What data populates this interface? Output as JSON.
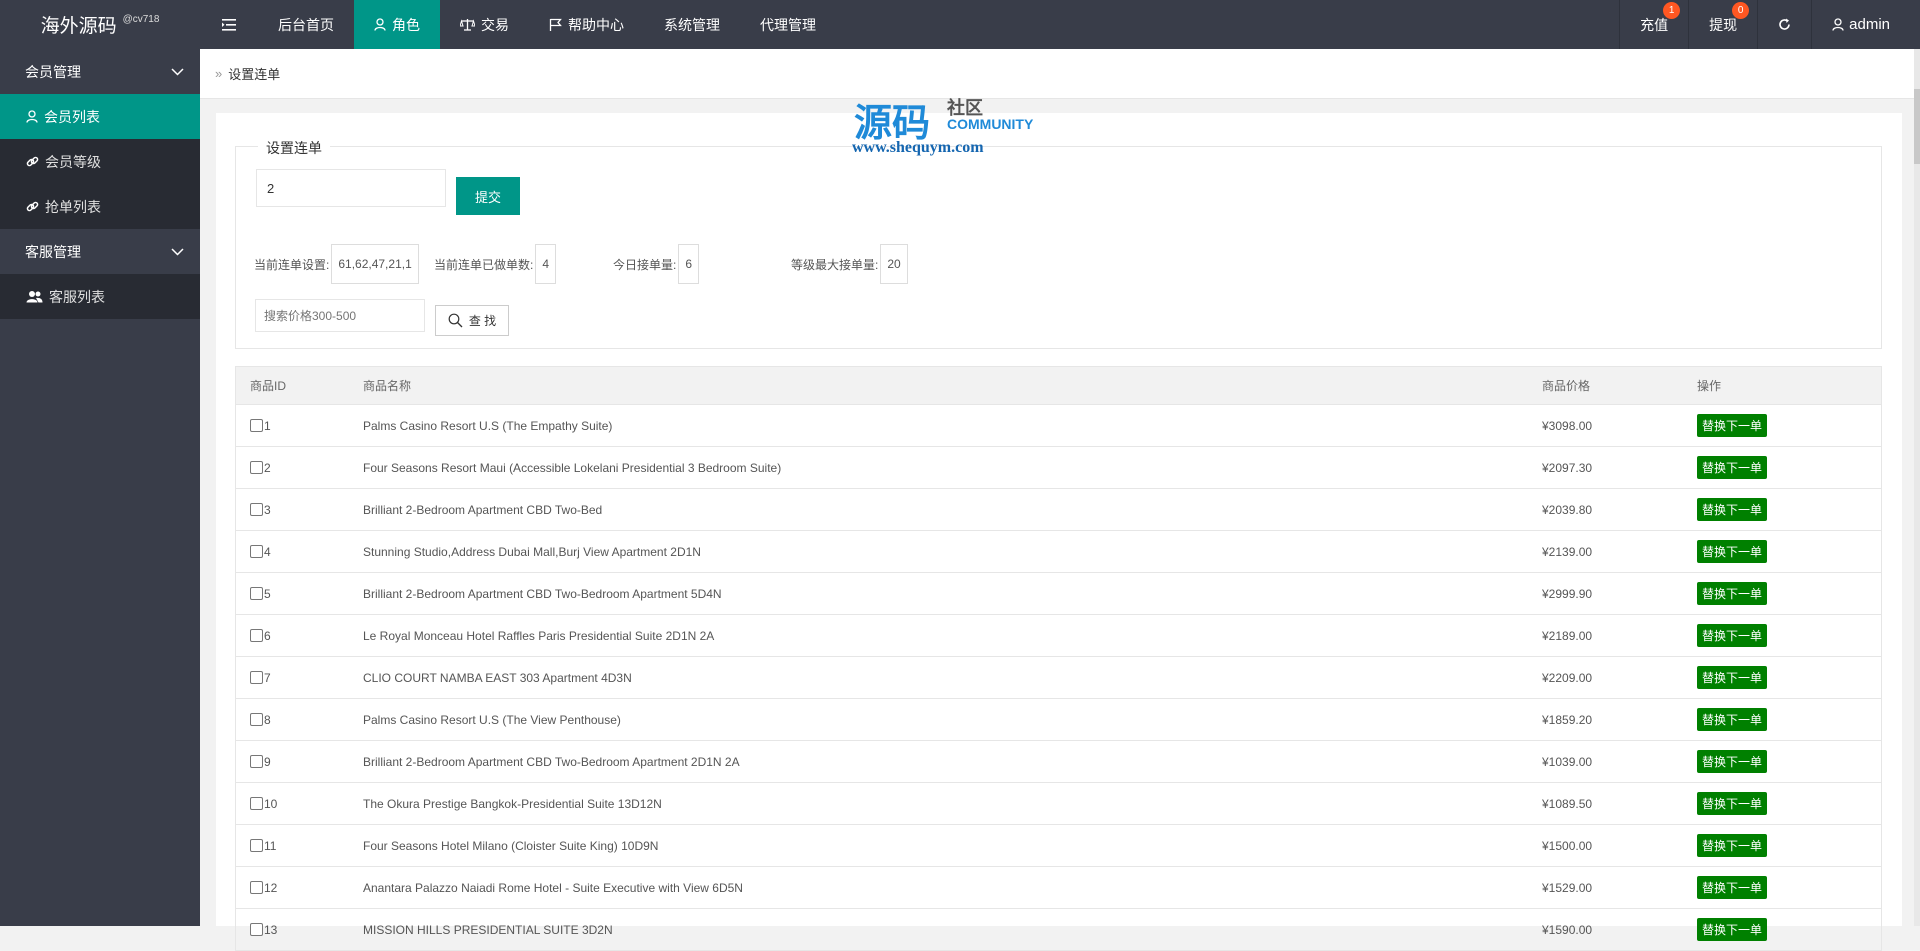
{
  "header": {
    "brand": "海外源码",
    "brand_sub": "@cv718",
    "nav": [
      {
        "label": "后台首页"
      },
      {
        "label": "角色",
        "active": true
      },
      {
        "label": "交易"
      },
      {
        "label": "帮助中心"
      },
      {
        "label": "系统管理"
      },
      {
        "label": "代理管理"
      }
    ],
    "recharge_label": "充值",
    "recharge_badge": "1",
    "withdraw_label": "提现",
    "withdraw_badge": "0",
    "user": "admin"
  },
  "sidebar": {
    "groups": [
      {
        "label": "会员管理",
        "items": [
          "会员列表",
          "会员等级",
          "抢单列表"
        ]
      },
      {
        "label": "客服管理",
        "items": [
          "客服列表"
        ]
      }
    ]
  },
  "breadcrumb": "设置连单",
  "form": {
    "legend": "设置连单",
    "chain_value": "2",
    "submit_label": "提交",
    "stats": [
      {
        "label": "当前连单设置:",
        "value": "61,62,47,21,1"
      },
      {
        "label": "当前连单已做单数:",
        "value": "4"
      },
      {
        "label": "今日接单量:",
        "value": "6"
      },
      {
        "label": "等级最大接单量:",
        "value": "20"
      }
    ],
    "search_placeholder": "搜索价格300-500",
    "search_label": "查 找"
  },
  "table": {
    "headers": [
      "商品ID",
      "商品名称",
      "商品价格",
      "操作"
    ],
    "action_label": "替换下一单",
    "rows": [
      {
        "id": "1",
        "name": "Palms Casino Resort U.S (The Empathy Suite)",
        "price": "¥3098.00"
      },
      {
        "id": "2",
        "name": "Four Seasons Resort Maui (Accessible Lokelani Presidential 3 Bedroom Suite)",
        "price": "¥2097.30"
      },
      {
        "id": "3",
        "name": "Brilliant 2-Bedroom Apartment CBD Two-Bed",
        "price": "¥2039.80"
      },
      {
        "id": "4",
        "name": "Stunning Studio,Address Dubai Mall,Burj View Apartment 2D1N",
        "price": "¥2139.00"
      },
      {
        "id": "5",
        "name": "Brilliant 2-Bedroom Apartment CBD Two-Bedroom Apartment 5D4N",
        "price": "¥2999.90"
      },
      {
        "id": "6",
        "name": "Le Royal Monceau Hotel Raffles Paris Presidential Suite 2D1N 2A",
        "price": "¥2189.00"
      },
      {
        "id": "7",
        "name": "CLIO COURT NAMBA EAST 303 Apartment 4D3N",
        "price": "¥2209.00"
      },
      {
        "id": "8",
        "name": "Palms Casino Resort U.S (The View Penthouse)",
        "price": "¥1859.20"
      },
      {
        "id": "9",
        "name": "Brilliant 2-Bedroom Apartment CBD Two-Bedroom Apartment 2D1N 2A",
        "price": "¥1039.00"
      },
      {
        "id": "10",
        "name": "The Okura Prestige Bangkok-Presidential Suite 13D12N",
        "price": "¥1089.50"
      },
      {
        "id": "11",
        "name": "Four Seasons Hotel Milano (Cloister Suite King) 10D9N",
        "price": "¥1500.00"
      },
      {
        "id": "12",
        "name": "Anantara Palazzo Naiadi Rome Hotel - Suite Executive with View 6D5N",
        "price": "¥1529.00"
      },
      {
        "id": "13",
        "name": "MISSION HILLS PRESIDENTIAL SUITE 3D2N",
        "price": "¥1590.00"
      }
    ]
  },
  "watermark": {
    "big": "源码",
    "she": "社区",
    "com": "COMMUNITY",
    "url": "www.shequym.com"
  }
}
